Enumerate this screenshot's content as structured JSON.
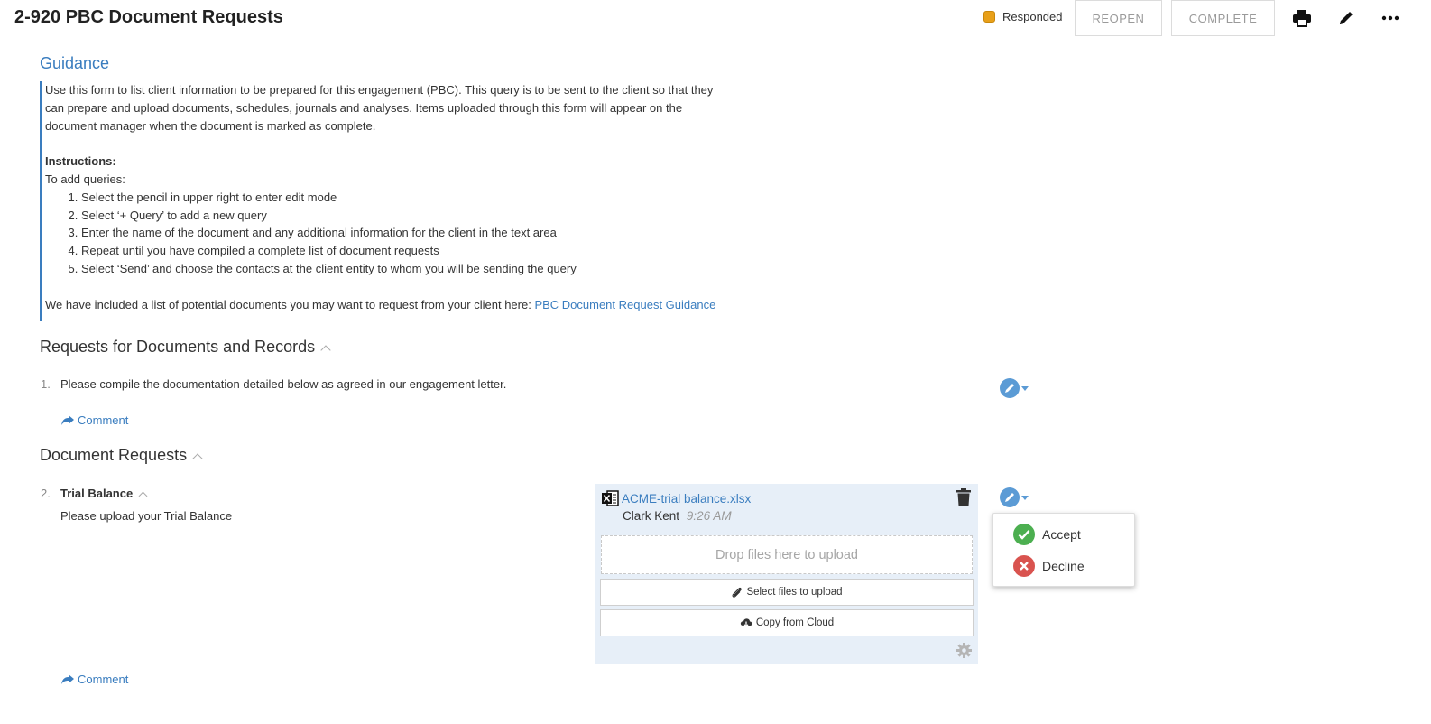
{
  "header": {
    "title": "2-920 PBC Document Requests",
    "status_label": "Responded",
    "status_color": "#e8a019",
    "reopen_label": "REOPEN",
    "complete_label": "COMPLETE",
    "icons": [
      "printer-icon",
      "pencil-icon",
      "more-icon"
    ]
  },
  "guidance": {
    "title": "Guidance",
    "intro_lines": [
      "Use this form to list client information to be prepared for this engagement (PBC). This query is to be sent to the client so that they",
      "can prepare and upload documents, schedules, journals and analyses. Items uploaded through this form will appear on the",
      "document manager when the document is marked as complete."
    ],
    "instructions_heading": "Instructions:",
    "to_add_label": "To add queries:",
    "steps": [
      "Select the pencil in upper right to enter edit mode",
      "Select ‘+ Query’ to add a new query",
      "Enter the name of the document and any additional information for the client in the text area",
      "Repeat until you have compiled a complete list of document requests",
      "Select ‘Send’ and choose the contacts at the client entity to whom you will be sending the query"
    ],
    "closing_text": "We have included a list of potential documents you may want to request from your client here: ",
    "link_text": "PBC Document Request Guidance"
  },
  "sections": [
    {
      "title": "Requests for Documents and Records",
      "items": [
        {
          "number": "1.",
          "text": "Please compile the documentation detailed below as agreed in our engagement letter.",
          "comment_label": "Comment"
        }
      ]
    },
    {
      "title": "Document Requests",
      "items": [
        {
          "number": "2.",
          "title": "Trial Balance",
          "text": "Please upload your Trial Balance",
          "comment_label": "Comment"
        }
      ]
    }
  ],
  "upload": {
    "file_name": "ACME-trial balance.xlsx",
    "uploader": "Clark Kent",
    "time": "9:26 AM",
    "dropzone_text": "Drop files here to upload",
    "select_files_label": "Select files to upload",
    "copy_cloud_label": "Copy from Cloud"
  },
  "action_menu": {
    "accept_label": "Accept",
    "decline_label": "Decline",
    "accept_color": "#4caf50",
    "decline_color": "#d9534f"
  },
  "colors": {
    "accent": "#3a7dbf",
    "panel_bg": "#e7eff8"
  }
}
